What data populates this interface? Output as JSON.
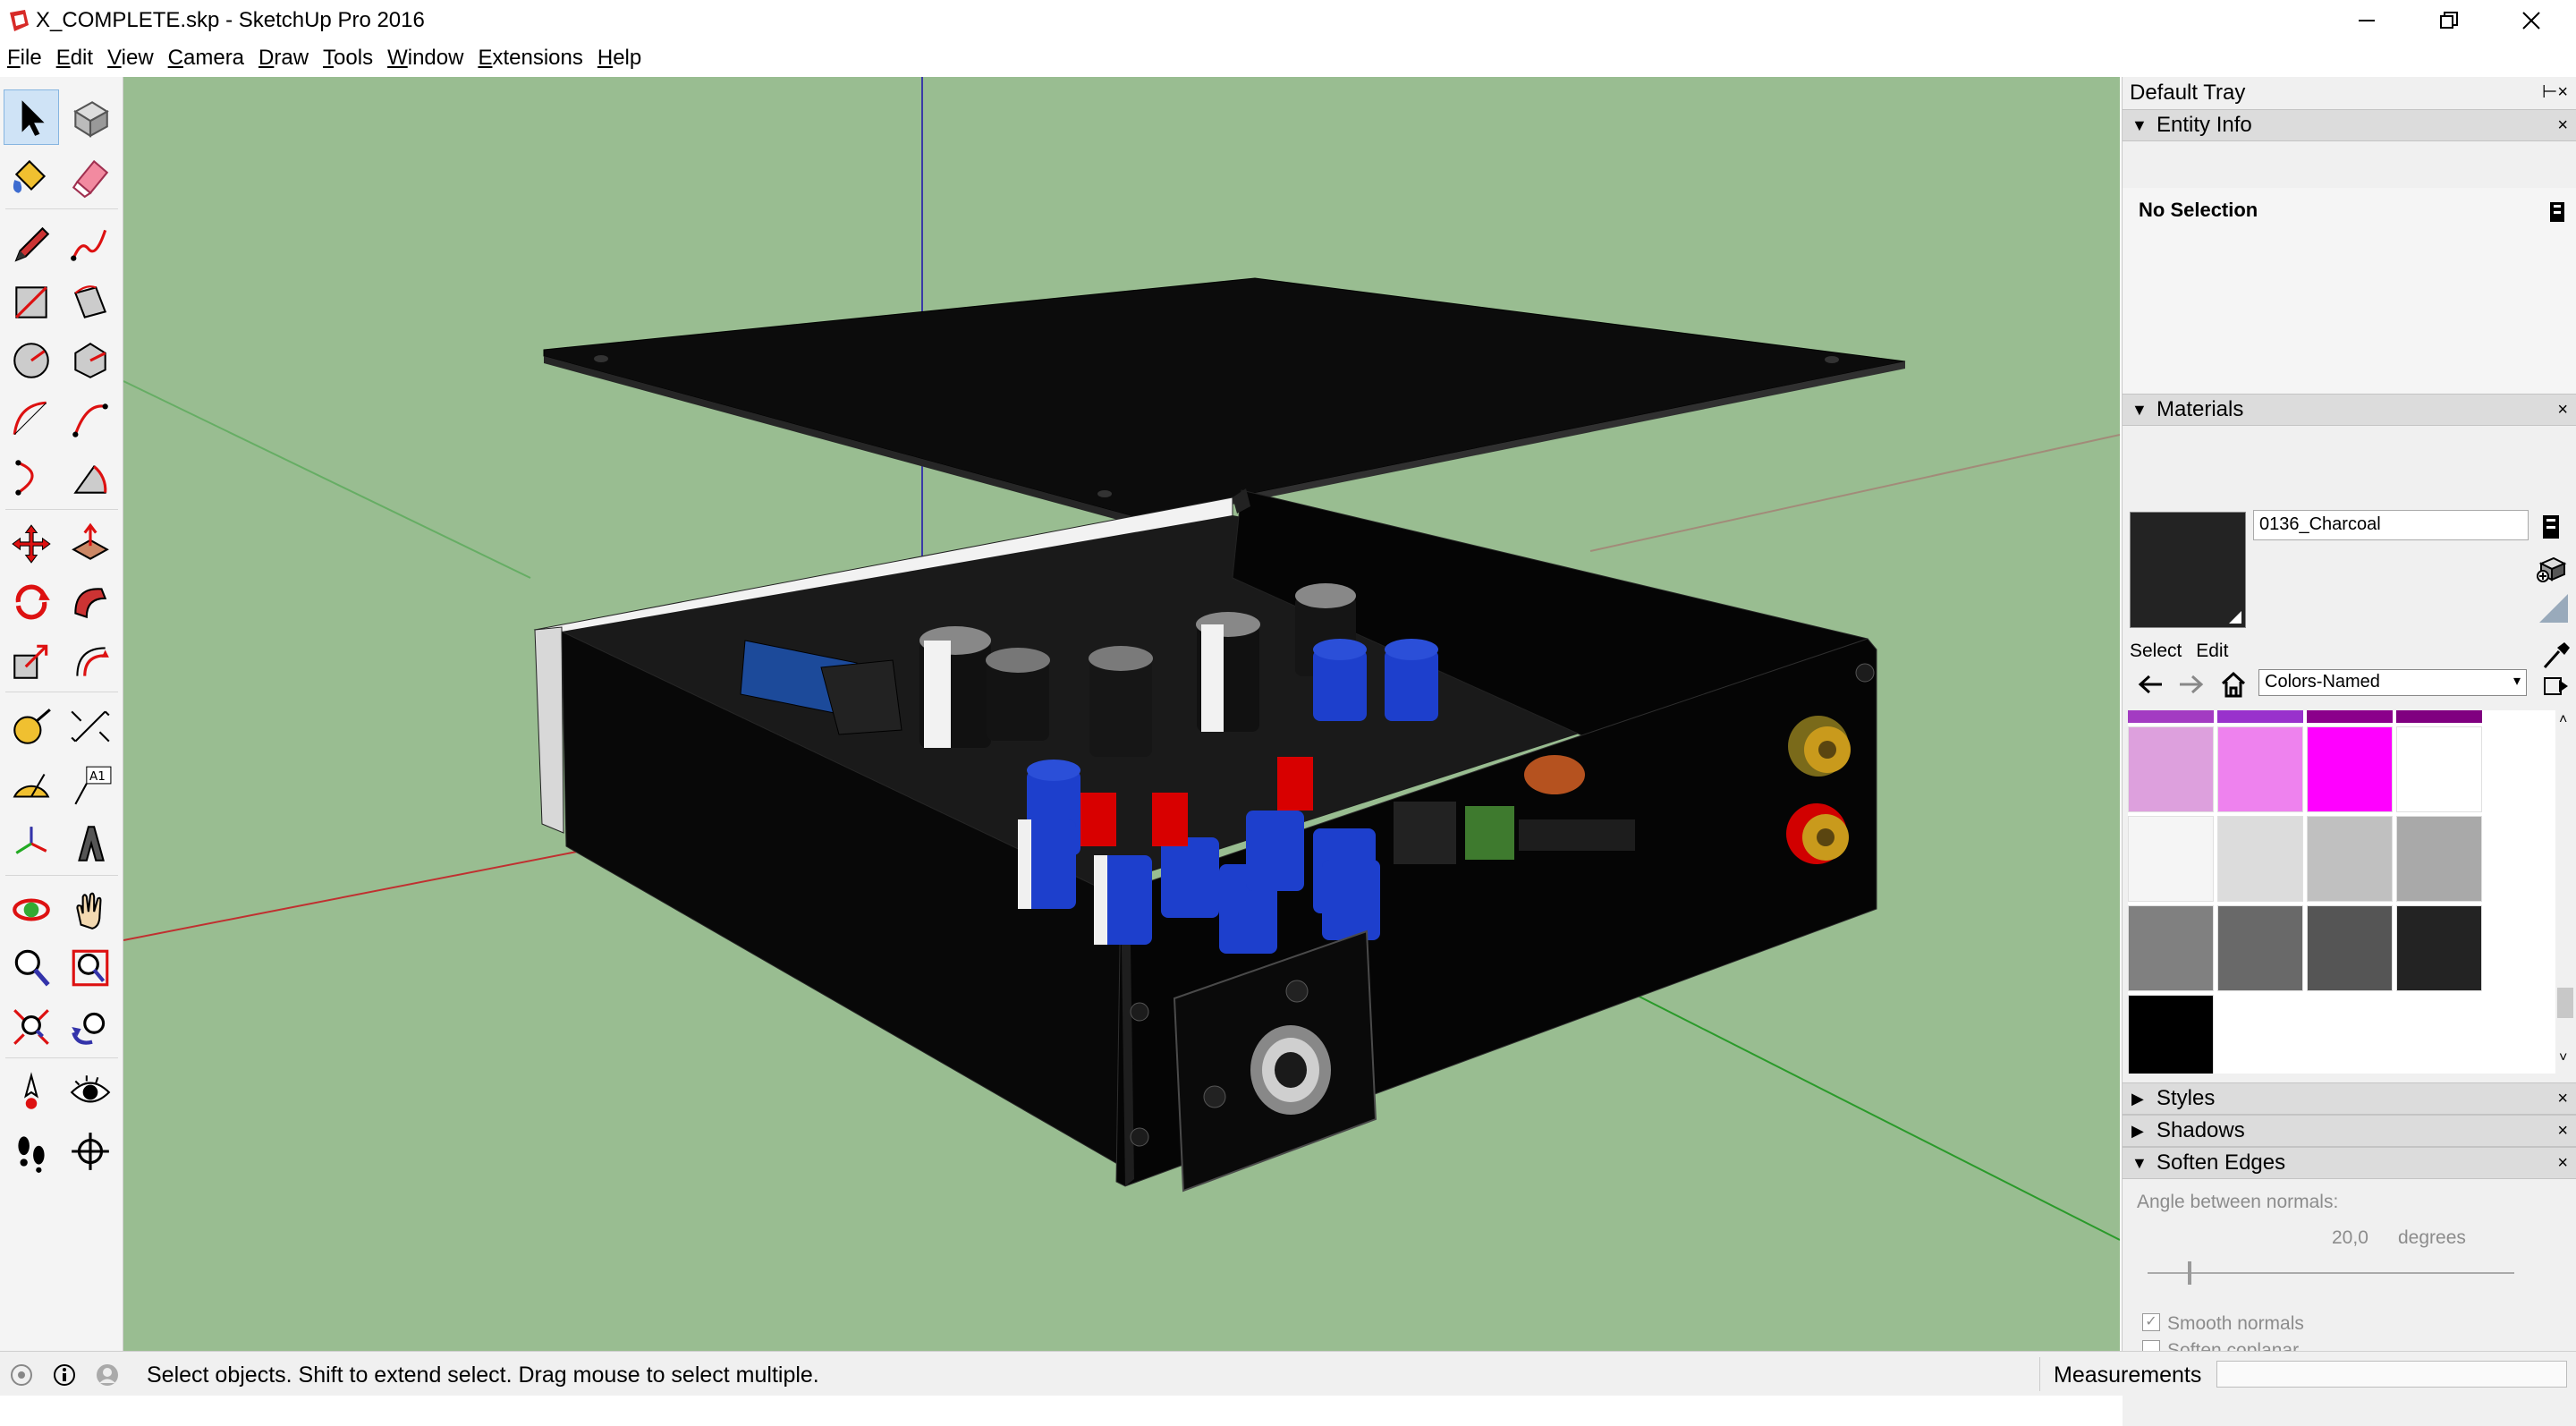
{
  "window": {
    "title": "X_COMPLETE.skp - SketchUp Pro 2016"
  },
  "menu": [
    {
      "label": "File",
      "u": "F",
      "rest": "ile"
    },
    {
      "label": "Edit",
      "u": "E",
      "rest": "dit"
    },
    {
      "label": "View",
      "u": "V",
      "rest": "iew"
    },
    {
      "label": "Camera",
      "u": "C",
      "rest": "amera"
    },
    {
      "label": "Draw",
      "u": "D",
      "rest": "raw"
    },
    {
      "label": "Tools",
      "u": "T",
      "rest": "ools"
    },
    {
      "label": "Window",
      "u": "W",
      "rest": "indow"
    },
    {
      "label": "Extensions",
      "u": "E",
      "rest": "xtensions"
    },
    {
      "label": "Help",
      "u": "H",
      "rest": "elp"
    }
  ],
  "toolbar": {
    "tools": [
      "select-icon",
      "make-component-icon",
      "paint-bucket-icon",
      "eraser-icon",
      "pencil-icon",
      "freehand-icon",
      "rectangle-icon",
      "rotated-rectangle-icon",
      "circle-icon",
      "polygon-icon",
      "arc-icon",
      "two-point-arc-icon",
      "three-point-arc-icon",
      "pie-icon",
      "move-icon",
      "push-pull-icon",
      "rotate-icon",
      "follow-me-icon",
      "scale-icon",
      "offset-icon",
      "tape-measure-icon",
      "dimension-icon",
      "protractor-icon",
      "text-icon",
      "axes-icon",
      "3d-text-icon",
      "orbit-icon",
      "pan-icon",
      "zoom-icon",
      "zoom-window-icon",
      "zoom-extents-icon",
      "previous-view-icon",
      "position-camera-icon",
      "look-around-icon",
      "walk-icon",
      "section-plane-icon"
    ],
    "text_tool_label": "A1"
  },
  "tray": {
    "title": "Default Tray",
    "entity_info": {
      "label": "Entity Info",
      "selection": "No Selection"
    },
    "materials": {
      "label": "Materials",
      "current_name": "0136_Charcoal",
      "current_color": "#232323",
      "tab_select": "Select",
      "tab_edit": "Edit",
      "library": "Colors-Named",
      "top_row_colors": [
        "#a33bc2",
        "#9932cc",
        "#8b008b",
        "#800080"
      ],
      "swatches": [
        [
          "#dda0dd",
          "#ee82ee",
          "#ff00ff",
          "#ffffff"
        ],
        [
          "#f5f5f5",
          "#dcdcdc",
          "#c0c0c0",
          "#a9a9a9"
        ],
        [
          "#808080",
          "#696969",
          "#555555",
          "#232323"
        ],
        [
          "#000000"
        ]
      ]
    },
    "styles": {
      "label": "Styles"
    },
    "shadows": {
      "label": "Shadows"
    },
    "soften_edges": {
      "label": "Soften Edges",
      "angle_label": "Angle between normals:",
      "angle_value": "20,0",
      "angle_unit": "degrees",
      "angle_fraction": 0.11,
      "smooth_normals": "Smooth normals",
      "smooth_checked": true,
      "soften_coplanar": "Soften coplanar",
      "coplanar_checked": false
    }
  },
  "status": {
    "hint": "Select objects. Shift to extend select. Drag mouse to select multiple.",
    "measurements_label": "Measurements",
    "measurements_value": ""
  },
  "colors": {
    "viewport_bg": "#99bd91",
    "box_black": "#0d0d0d",
    "capacitor_blue": "#1d3fcc",
    "rca_gold": "#c99a1c",
    "rca_red": "#d10000"
  }
}
